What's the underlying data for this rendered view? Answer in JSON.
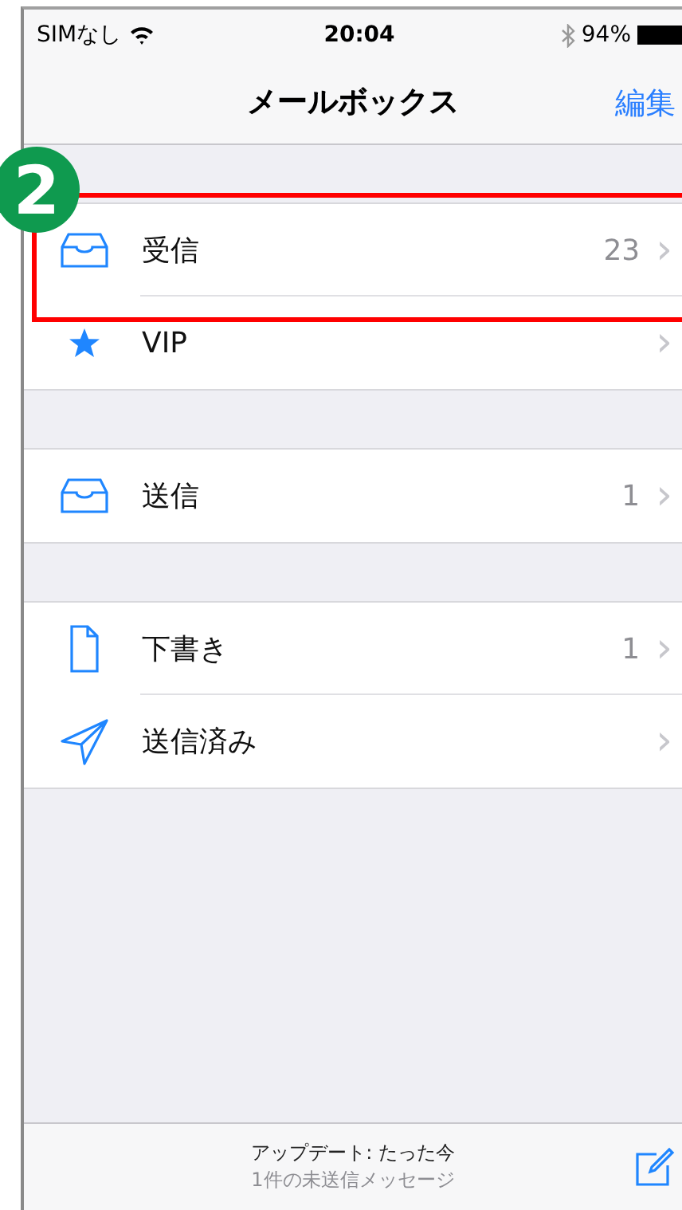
{
  "status_bar": {
    "carrier": "SIMなし",
    "time": "20:04",
    "battery": "94%"
  },
  "nav_bar": {
    "title": "メールボックス",
    "edit": "編集"
  },
  "groups": [
    [
      {
        "kind": "tray",
        "label": "受信",
        "count": "23",
        "chevron": "›"
      },
      {
        "kind": "star",
        "label": "VIP",
        "chevron": "›"
      }
    ],
    [
      {
        "kind": "tray",
        "label": "送信",
        "count": "1",
        "chevron": "›"
      }
    ],
    [
      {
        "kind": "document",
        "label": "下書き",
        "count": "1",
        "chevron": "›"
      },
      {
        "kind": "plane",
        "label": "送信済み",
        "chevron": "›"
      }
    ]
  ],
  "toolbar": {
    "update": "アップデート: たった今",
    "unsent": "1件の未送信メッセージ"
  },
  "annotation": {
    "step": "2"
  }
}
